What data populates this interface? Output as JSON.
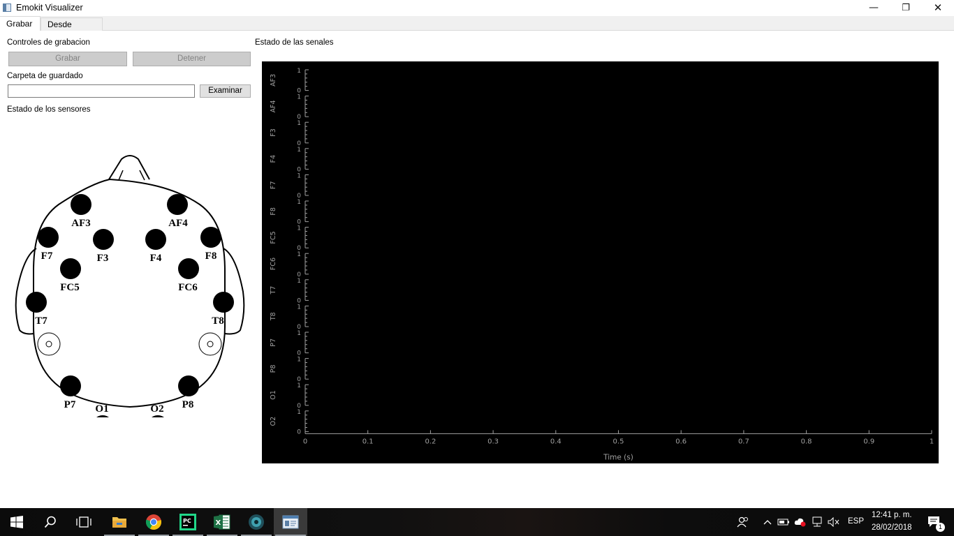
{
  "window": {
    "title": "Emokit Visualizer",
    "controls": {
      "minimize": "—",
      "maximize": "❐",
      "close": "✕"
    }
  },
  "tabs": [
    {
      "label": "Grabar",
      "active": true
    },
    {
      "label": "Desde archivo",
      "active": false
    }
  ],
  "recording": {
    "section_label": "Controles de grabacion",
    "record_button": "Grabar",
    "stop_button": "Detener",
    "folder_label": "Carpeta de guardado",
    "folder_value": "",
    "browse_button": "Examinar",
    "sensors_label": "Estado de los sensores"
  },
  "sensors": [
    {
      "name": "AF3"
    },
    {
      "name": "AF4"
    },
    {
      "name": "F7"
    },
    {
      "name": "F3"
    },
    {
      "name": "F4"
    },
    {
      "name": "F8"
    },
    {
      "name": "FC5"
    },
    {
      "name": "FC6"
    },
    {
      "name": "T7"
    },
    {
      "name": "T8"
    },
    {
      "name": "P7"
    },
    {
      "name": "P8"
    },
    {
      "name": "O1"
    },
    {
      "name": "O2"
    }
  ],
  "signals": {
    "section_label": "Estado de las senales"
  },
  "chart_data": {
    "type": "line",
    "xlabel": "Time (s)",
    "xlim": [
      0,
      1
    ],
    "x_ticks": [
      "0",
      "0.1",
      "0.2",
      "0.3",
      "0.4",
      "0.5",
      "0.6",
      "0.7",
      "0.8",
      "0.9",
      "1"
    ],
    "channels": [
      "AF3",
      "AF4",
      "F3",
      "F4",
      "F7",
      "F8",
      "FC5",
      "FC6",
      "T7",
      "T8",
      "P7",
      "P8",
      "O1",
      "O2"
    ],
    "channel_ylim": [
      0,
      1
    ],
    "channel_ticks": [
      "1",
      "0"
    ],
    "series": [],
    "background": "#000000",
    "axis_color": "#a0a0a0"
  },
  "taskbar": {
    "apps": [
      {
        "name": "start-icon"
      },
      {
        "name": "search-icon"
      },
      {
        "name": "task-view-icon"
      },
      {
        "name": "file-explorer-icon"
      },
      {
        "name": "chrome-icon"
      },
      {
        "name": "pycharm-icon"
      },
      {
        "name": "excel-icon"
      },
      {
        "name": "app-icon"
      },
      {
        "name": "emokit-visualizer-icon"
      }
    ],
    "language": "ESP",
    "time": "12:41 p. m.",
    "date": "28/02/2018",
    "notifications": "1"
  }
}
